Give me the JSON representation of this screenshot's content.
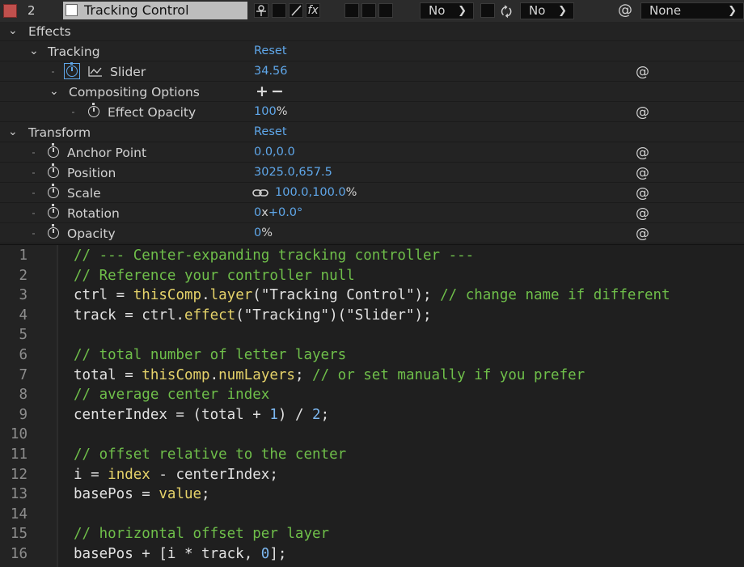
{
  "layer": {
    "number": "2",
    "name": "Tracking Control",
    "label_color": "#c0504d",
    "mode_dropdown": "No",
    "trkmat_dropdown": "No",
    "parent_dropdown": "None",
    "switch_fx_label": "fx"
  },
  "properties": {
    "effects": {
      "label": "Effects"
    },
    "tracking": {
      "label": "Tracking",
      "reset": "Reset"
    },
    "slider": {
      "label": "Slider",
      "value": "34.56"
    },
    "compositing": {
      "label": "Compositing Options",
      "plus": "+",
      "minus": "−"
    },
    "effect_opacity": {
      "label": "Effect Opacity",
      "value": "100",
      "unit": "%"
    },
    "transform": {
      "label": "Transform",
      "reset": "Reset"
    },
    "anchor_point": {
      "label": "Anchor Point",
      "value": "0.0,0.0"
    },
    "position": {
      "label": "Position",
      "value": "3025.0,657.5"
    },
    "scale": {
      "label": "Scale",
      "value": "100.0,100.0",
      "unit": "%"
    },
    "rotation": {
      "label": "Rotation",
      "value_turns": "0",
      "value_x": "x",
      "value_deg": "+0.0°"
    },
    "opacity": {
      "label": "Opacity",
      "value": "0",
      "unit": "%"
    }
  },
  "editor": {
    "lines": [
      {
        "n": "1",
        "parts": [
          {
            "t": "// --- Center-expanding tracking controller ---",
            "c": "com"
          }
        ]
      },
      {
        "n": "2",
        "parts": [
          {
            "t": "// Reference your controller null",
            "c": "com"
          }
        ]
      },
      {
        "n": "3",
        "parts": [
          {
            "t": "ctrl = ",
            "c": "op"
          },
          {
            "t": "thisComp",
            "c": "fn"
          },
          {
            "t": ".",
            "c": "op"
          },
          {
            "t": "layer",
            "c": "fn"
          },
          {
            "t": "(\"Tracking Control\"); ",
            "c": "str"
          },
          {
            "t": "// change name if different",
            "c": "com"
          }
        ]
      },
      {
        "n": "4",
        "parts": [
          {
            "t": "track = ctrl.",
            "c": "op"
          },
          {
            "t": "effect",
            "c": "fn"
          },
          {
            "t": "(\"Tracking\")(\"Slider\");",
            "c": "str"
          }
        ]
      },
      {
        "n": "5",
        "parts": []
      },
      {
        "n": "6",
        "parts": [
          {
            "t": "// total number of letter layers",
            "c": "com"
          }
        ]
      },
      {
        "n": "7",
        "parts": [
          {
            "t": "total = ",
            "c": "op"
          },
          {
            "t": "thisComp",
            "c": "fn"
          },
          {
            "t": ".",
            "c": "op"
          },
          {
            "t": "numLayers",
            "c": "fn"
          },
          {
            "t": "; ",
            "c": "op"
          },
          {
            "t": "// or set manually if you prefer",
            "c": "com"
          }
        ]
      },
      {
        "n": "8",
        "parts": [
          {
            "t": "// average center index",
            "c": "com"
          }
        ]
      },
      {
        "n": "9",
        "parts": [
          {
            "t": "centerIndex = (total + ",
            "c": "op"
          },
          {
            "t": "1",
            "c": "num"
          },
          {
            "t": ") / ",
            "c": "op"
          },
          {
            "t": "2",
            "c": "num"
          },
          {
            "t": ";",
            "c": "op"
          }
        ]
      },
      {
        "n": "10",
        "parts": []
      },
      {
        "n": "11",
        "parts": [
          {
            "t": "// offset relative to the center",
            "c": "com"
          }
        ]
      },
      {
        "n": "12",
        "parts": [
          {
            "t": "i = ",
            "c": "op"
          },
          {
            "t": "index",
            "c": "fn"
          },
          {
            "t": " - centerIndex;",
            "c": "op"
          }
        ]
      },
      {
        "n": "13",
        "parts": [
          {
            "t": "basePos = ",
            "c": "op"
          },
          {
            "t": "value",
            "c": "fn"
          },
          {
            "t": ";",
            "c": "op"
          }
        ]
      },
      {
        "n": "14",
        "parts": []
      },
      {
        "n": "15",
        "parts": [
          {
            "t": "// horizontal offset per layer",
            "c": "com"
          }
        ]
      },
      {
        "n": "16",
        "parts": [
          {
            "t": "basePos + [i * track, ",
            "c": "op"
          },
          {
            "t": "0",
            "c": "num"
          },
          {
            "t": "];",
            "c": "op"
          }
        ]
      }
    ]
  },
  "colors": {
    "accent_blue": "#5fa7ea",
    "comment_green": "#6fbf4a",
    "keyword_yellow": "#e6d36a",
    "number_blue": "#7cb7f0"
  }
}
